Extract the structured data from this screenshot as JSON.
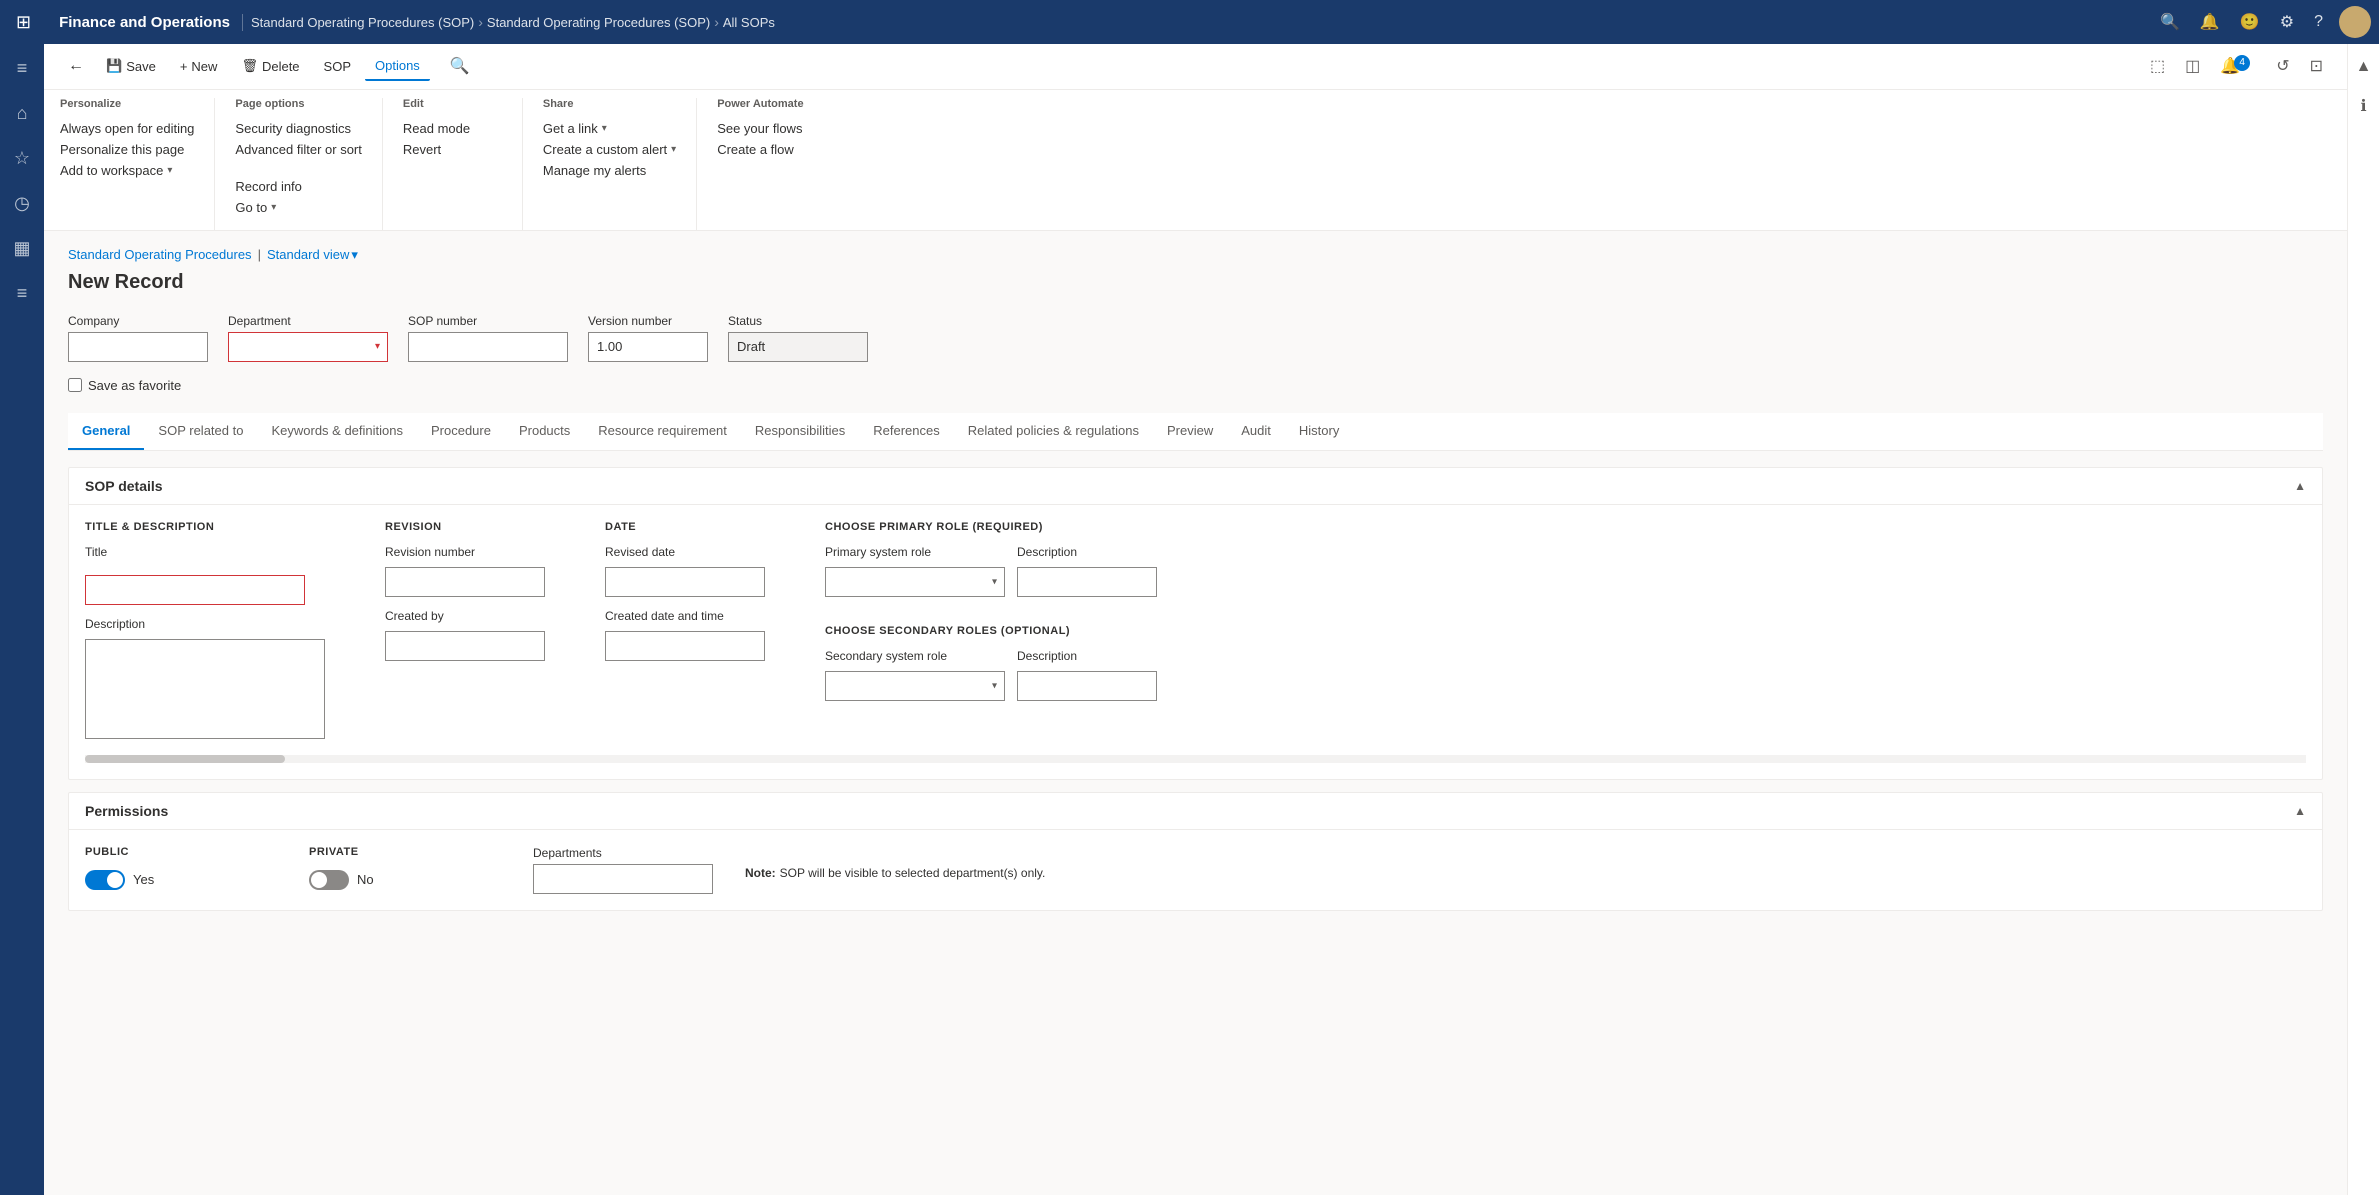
{
  "app": {
    "title": "Finance and Operations",
    "grid_icon": "⊞"
  },
  "breadcrumb": {
    "items": [
      {
        "label": "Standard Operating Procedures (SOP)"
      },
      {
        "label": "Standard Operating Procedures (SOP)"
      },
      {
        "label": "All SOPs"
      }
    ]
  },
  "top_nav_icons": {
    "search": "🔍",
    "bell": "🔔",
    "smiley": "🙂",
    "settings": "⚙",
    "help": "?",
    "avatar_initials": ""
  },
  "left_sidebar": {
    "icons": [
      "≡",
      "⌂",
      "☆",
      "◷",
      "▦",
      "≡"
    ]
  },
  "toolbar": {
    "back_label": "←",
    "save_label": "Save",
    "new_label": "New",
    "delete_label": "Delete",
    "sop_label": "SOP",
    "options_label": "Options",
    "search_icon": "🔍",
    "right_icons": [
      "⬚",
      "◫",
      "🔔",
      "↺",
      "⊡"
    ]
  },
  "options_menu": {
    "groups": [
      {
        "title": "Personalize",
        "items": [
          {
            "label": "Always open for editing",
            "arrow": false
          },
          {
            "label": "Personalize this page",
            "arrow": false
          },
          {
            "label": "Add to workspace",
            "arrow": true
          }
        ]
      },
      {
        "title": "Page options",
        "items": [
          {
            "label": "Security diagnostics",
            "arrow": false
          },
          {
            "label": "Advanced filter or sort",
            "arrow": false
          }
        ]
      },
      {
        "title": "",
        "items": [
          {
            "label": "Record info",
            "arrow": false
          },
          {
            "label": "Go to",
            "arrow": true
          }
        ]
      },
      {
        "title": "Edit",
        "items": [
          {
            "label": "Read mode",
            "arrow": false
          },
          {
            "label": "Revert",
            "arrow": false
          }
        ]
      },
      {
        "title": "Share",
        "items": [
          {
            "label": "Get a link",
            "arrow": true
          },
          {
            "label": "Create a custom alert",
            "arrow": true
          },
          {
            "label": "Manage my alerts",
            "arrow": false
          }
        ]
      },
      {
        "title": "Power Automate",
        "items": [
          {
            "label": "See your flows",
            "arrow": false
          },
          {
            "label": "Create a flow",
            "arrow": false
          }
        ]
      }
    ]
  },
  "page": {
    "breadcrumb_link": "Standard Operating Procedures",
    "view_label": "Standard view",
    "record_title": "New Record"
  },
  "form": {
    "company_label": "Company",
    "company_value": "",
    "department_label": "Department",
    "department_value": "",
    "sop_number_label": "SOP number",
    "sop_number_value": "",
    "version_label": "Version number",
    "version_value": "1.00",
    "status_label": "Status",
    "status_value": "Draft",
    "save_as_favorite_label": "Save as favorite"
  },
  "tabs": [
    {
      "label": "General",
      "active": true
    },
    {
      "label": "SOP related to",
      "active": false
    },
    {
      "label": "Keywords & definitions",
      "active": false
    },
    {
      "label": "Procedure",
      "active": false
    },
    {
      "label": "Products",
      "active": false
    },
    {
      "label": "Resource requirement",
      "active": false
    },
    {
      "label": "Responsibilities",
      "active": false
    },
    {
      "label": "References",
      "active": false
    },
    {
      "label": "Related policies & regulations",
      "active": false
    },
    {
      "label": "Preview",
      "active": false
    },
    {
      "label": "Audit",
      "active": false
    },
    {
      "label": "History",
      "active": false
    }
  ],
  "sop_details": {
    "card_title": "SOP details",
    "sections": {
      "title_desc": {
        "title": "TITLE & DESCRIPTION",
        "title_label": "Title",
        "title_required": true,
        "description_label": "Description"
      },
      "revision": {
        "title": "REVISION",
        "revision_number_label": "Revision number",
        "created_by_label": "Created by"
      },
      "date": {
        "title": "DATE",
        "revised_date_label": "Revised date",
        "created_date_label": "Created date and time"
      },
      "primary_role": {
        "title": "CHOOSE PRIMARY ROLE (REQUIRED)",
        "system_role_label": "Primary system role",
        "description_label": "Description"
      },
      "secondary_role": {
        "title": "CHOOSE SECONDARY ROLES (OPTIONAL)",
        "system_role_label": "Secondary system role",
        "description_label": "Description"
      }
    }
  },
  "permissions": {
    "card_title": "Permissions",
    "public_section": {
      "title": "PUBLIC",
      "label": "Public",
      "value": "Yes",
      "enabled": true
    },
    "private_section": {
      "title": "PRIVATE",
      "label": "Private",
      "value": "No",
      "enabled": false
    },
    "departments_section": {
      "label": "Departments"
    },
    "note": {
      "label": "Note:",
      "text": "SOP will be visible to selected department(s) only."
    }
  }
}
